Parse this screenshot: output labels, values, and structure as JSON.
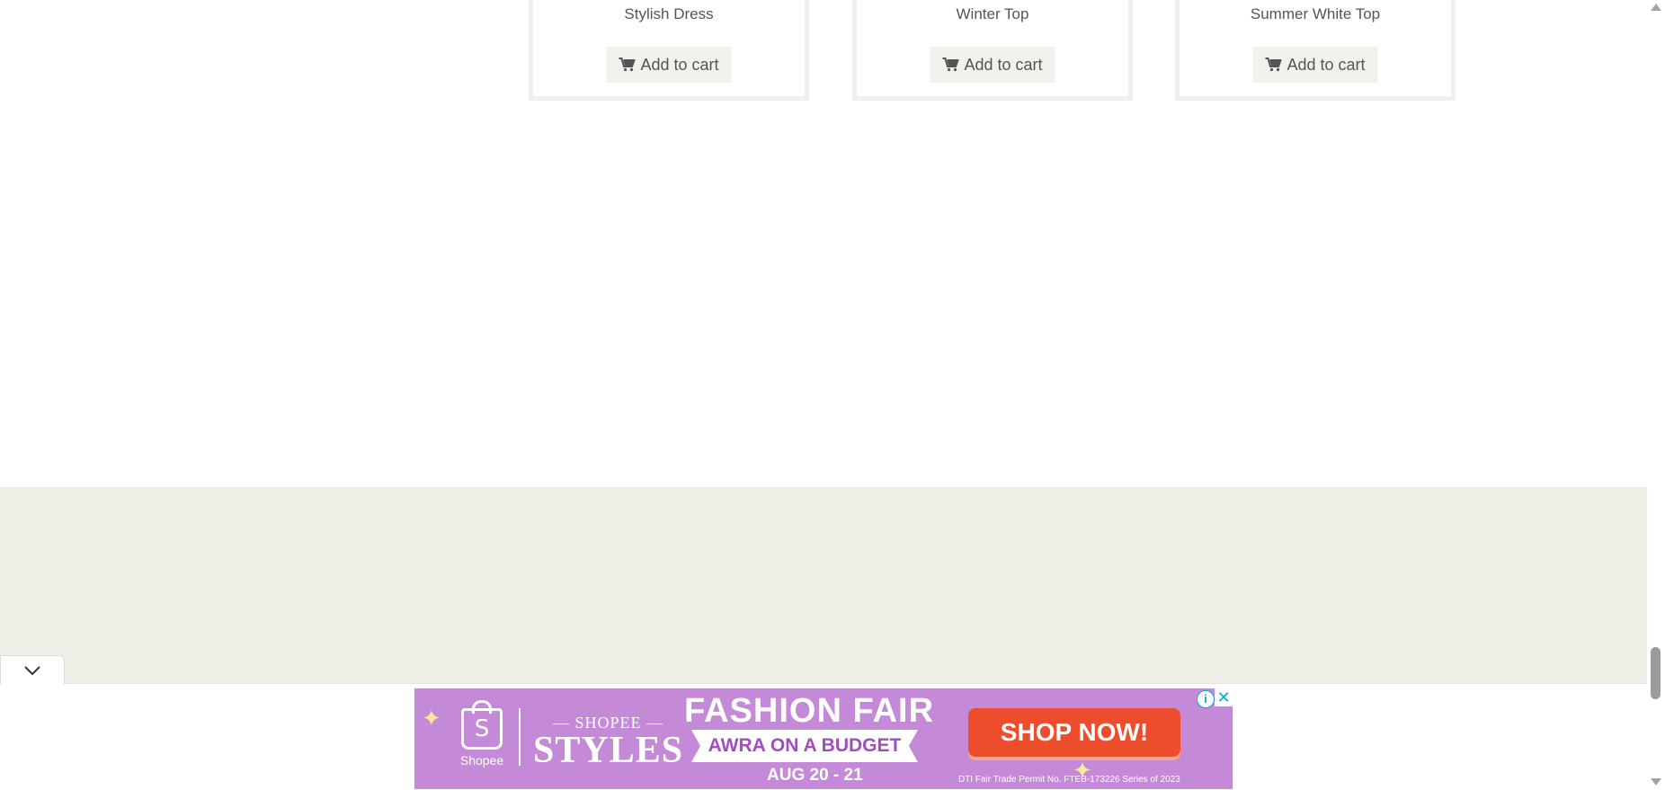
{
  "products": [
    {
      "title": "Stylish Dress",
      "button": "Add to cart"
    },
    {
      "title": "Winter Top",
      "button": "Add to cart"
    },
    {
      "title": "Summer White Top",
      "button": "Add to cart"
    }
  ],
  "icons": {
    "cart": "shopping-cart-icon",
    "collapse": "chevron-down-icon",
    "ad_info": "info-icon",
    "ad_close": "close-icon"
  },
  "ad": {
    "logo_text": "Shopee",
    "logo_glyph": "S",
    "brand_sub": "— SHOPEE —",
    "brand_main": "STYLES",
    "headline": "FASHION FAIR",
    "ribbon": "AWRA ON A BUDGET",
    "dates": "AUG 20 - 21",
    "cta": "SHOP NOW!",
    "permit": "DTI Fair Trade Permit No. FTEB-173226 Series of 2023",
    "info_glyph": "i",
    "close_glyph": "✕",
    "background": "#c48ad8",
    "cta_color": "#ee4d2d"
  },
  "colors": {
    "footer_bg": "#f0efe8",
    "button_bg": "#f2f1ec",
    "text": "#555555"
  }
}
